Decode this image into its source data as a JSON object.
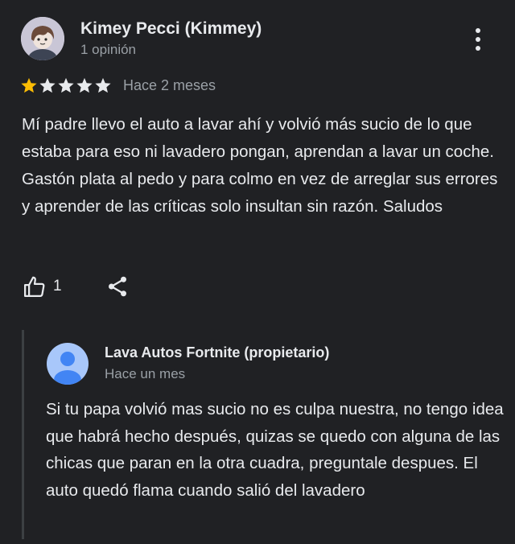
{
  "review": {
    "author": "Kimey Pecci (Kimmey)",
    "author_meta": "1 opinión",
    "rating": 1,
    "rating_max": 5,
    "date": "Hace 2 meses",
    "text": "Mí padre llevo el auto a lavar ahí y volvió más sucio de lo que estaba para eso ni lavadero pongan, aprendan a lavar un coche. Gastón plata al pedo y para colmo en vez de arreglar sus errores y aprender de las críticas solo insultan sin razón. Saludos",
    "like_count": "1"
  },
  "owner_reply": {
    "author": "Lava Autos Fortnite (propietario)",
    "date": "Hace un mes",
    "text": "Si tu papa volvió mas sucio no es culpa nuestra, no tengo idea que habrá hecho después, quizas se quedo con alguna de las chicas que paran en la otra cuadra, preguntale despues. El auto quedó flama cuando salió del lavadero"
  },
  "icons": {
    "more": "more-vert-icon",
    "like": "thumbs-up-icon",
    "share": "share-icon"
  },
  "colors": {
    "background": "#202124",
    "star_filled": "#fbbc04",
    "star_empty": "#e8eaed",
    "text_primary": "#e8eaed",
    "text_secondary": "#9aa0a6",
    "owner_avatar": "#a8c7fa",
    "owner_avatar_figure": "#4285f4"
  }
}
